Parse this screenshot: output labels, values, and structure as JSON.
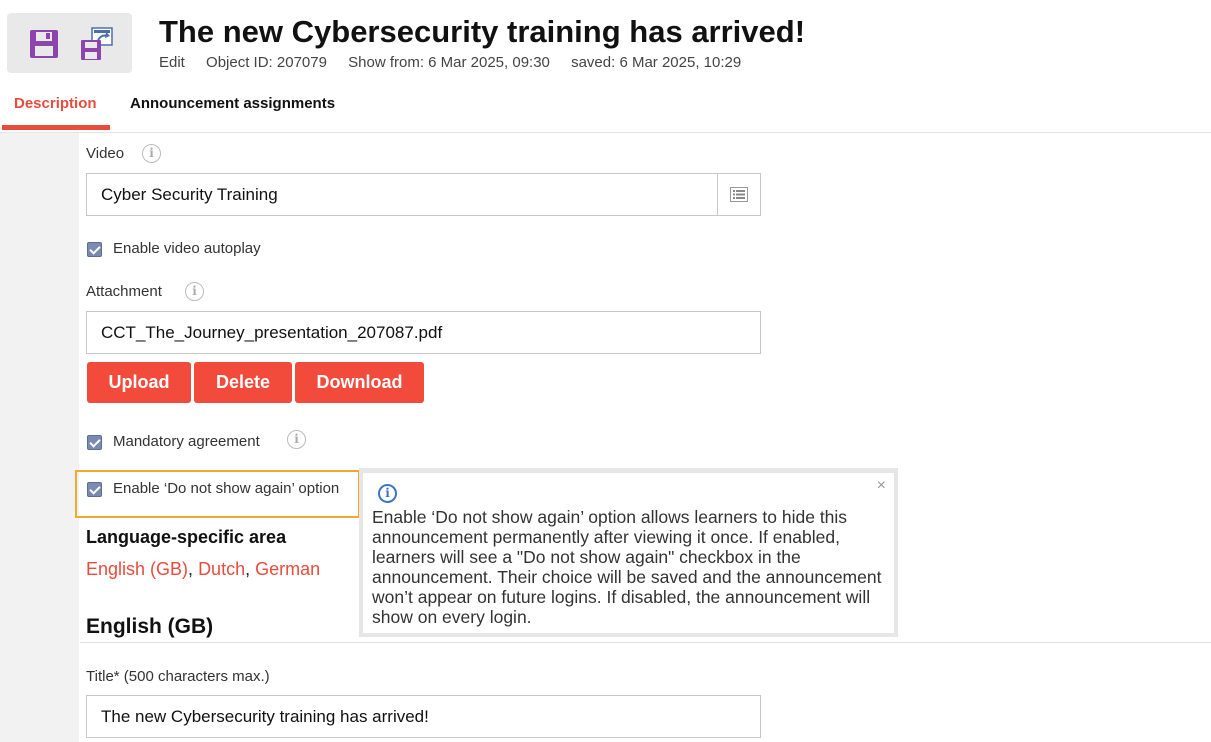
{
  "header": {
    "title": "The new Cybersecurity training has arrived!",
    "mode": "Edit",
    "object_id": "Object ID: 207079",
    "show_from": "Show from: 6 Mar 2025, 09:30",
    "saved": "saved: 6 Mar 2025, 10:29"
  },
  "toolbar": {
    "save_icon": "save-icon",
    "publish_icon": "save-publish-icon",
    "accent": "#8e44ad"
  },
  "tabs": [
    {
      "label": "Description",
      "active": true
    },
    {
      "label": "Announcement assignments",
      "active": false
    }
  ],
  "video": {
    "label": "Video",
    "value": "Cyber Security Training",
    "autoplay_label": "Enable video autoplay",
    "autoplay_checked": true
  },
  "attachment": {
    "label": "Attachment",
    "value": "CCT_The_Journey_presentation_207087.pdf",
    "buttons": {
      "upload": "Upload",
      "delete": "Delete",
      "download": "Download"
    }
  },
  "mandatory_agreement": {
    "label": "Mandatory agreement",
    "checked": true
  },
  "do_not_show_again": {
    "label": "Enable ‘Do not show again’ option",
    "checked": true
  },
  "tooltip": {
    "text": "Enable ‘Do not show again’ option allows learners to hide this announcement permanently after viewing it once. If enabled, learners will see a \"Do not show again\" checkbox in the announcement. Their choice will be saved and the announcement won’t appear on future logins. If disabled, the announcement will show on every login.",
    "close": "×"
  },
  "language_area": {
    "heading": "Language-specific area",
    "languages": [
      "English (GB)",
      "Dutch",
      "German"
    ],
    "separator": ", "
  },
  "english_section": {
    "heading": "English (GB)",
    "title_label": "Title* (500 characters max.)",
    "title_value": "The new Cybersecurity training has arrived!"
  },
  "colors": {
    "accent_red": "#f24b3c",
    "highlight": "#f0a830",
    "info_blue": "#3a73c8"
  }
}
